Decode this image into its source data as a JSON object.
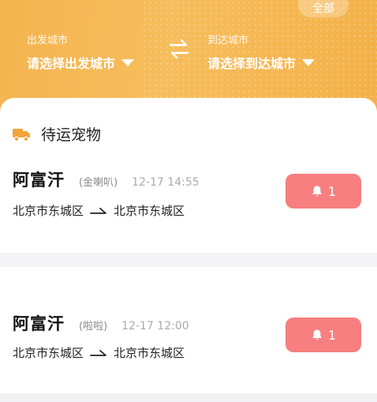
{
  "header": {
    "all_label": "全部",
    "from_caption": "出发城市",
    "from_select": "请选择出发城市",
    "to_caption": "到达城市",
    "to_select": "请选择到达城市"
  },
  "section": {
    "title": "待运宠物"
  },
  "shipments": [
    {
      "pet_name": "阿富汗",
      "breed": "(金喇叭)",
      "time": "12-17 14:55",
      "origin": "北京市东城区",
      "destination": "北京市东城区",
      "reminder_count": "1"
    },
    {
      "pet_name": "阿富汗",
      "breed": "(啦啦)",
      "time": "12-17 12:00",
      "origin": "北京市东城区",
      "destination": "北京市东城区",
      "reminder_count": "1"
    }
  ],
  "colors": {
    "header": "#f4b44f",
    "accent": "#f2a33a",
    "remind": "#f77f80"
  },
  "icons": [
    "swap-icon",
    "truck-icon",
    "arrow-right-icon",
    "bell-icon",
    "caret-down-icon"
  ]
}
